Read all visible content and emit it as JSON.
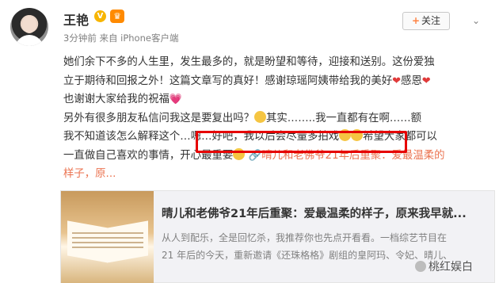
{
  "author": {
    "name": "王艳",
    "verified_badge": "V",
    "member_badge": "♛",
    "meta": "3分钟前 来自 iPhone客户端"
  },
  "follow_button": {
    "plus": "+",
    "label": "关注"
  },
  "post": {
    "line1": "她们余下不多的人生里，发生最多的，就是盼望和等待，迎接和送别。这份爱独",
    "line2a": "立于期待和回报之外！这篇文章写的真好！感谢琼瑶阿姨带给我的美好",
    "line2b": "感恩",
    "line3": "也谢谢大家给我的祝福",
    "line4a": "另外有很多朋友私信问我这是要复出吗？",
    "line4b": "其实……..我一直都有在啊……额",
    "line5a": "我不知道该怎么解释这个",
    "line5b": "…嗯…好吧，我以后会尽量多拍戏",
    "line5c": "希望大家都可以",
    "line6a": "一直做自己喜欢的事情，开心最重要",
    "line6link": "晴儿和老佛爷21年后重聚：爱最温柔的",
    "line7link": "样子，原..."
  },
  "card": {
    "title": "晴儿和老佛爷21年后重聚：爱最温柔的样子，原来我早就...",
    "desc1": "从人到配乐，全是回忆杀，我推荐你也先点开看看。一档综艺节目在",
    "desc2": "21 年后的今天，重新邀请《还珠格格》剧组的皇阿玛、令妃、晴儿、"
  },
  "watermark": "桃红娱白",
  "colors": {
    "link": "#eb7350",
    "highlight": "#e60000",
    "accent": "#ff8140"
  }
}
